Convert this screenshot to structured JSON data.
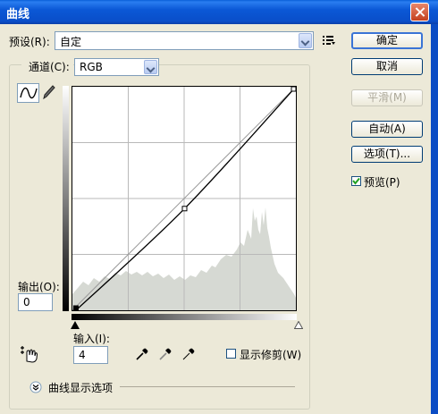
{
  "window": {
    "title": "曲线"
  },
  "preset": {
    "label": "预设(R):",
    "value": "自定"
  },
  "channel": {
    "label": "通道(C):",
    "value": "RGB"
  },
  "buttons": {
    "ok": "确定",
    "cancel": "取消",
    "smooth": "平滑(M)",
    "auto": "自动(A)",
    "options": "选项(T)..."
  },
  "preview": {
    "label": "预览(P)",
    "checked": true
  },
  "output": {
    "label": "输出(O):",
    "value": "0"
  },
  "input": {
    "label": "输入(I):",
    "value": "4"
  },
  "show_clipping": {
    "label": "显示修剪(W)",
    "checked": false
  },
  "curve_options": {
    "label": "曲线显示选项"
  },
  "curve": {
    "points": [
      [
        4,
        0
      ],
      [
        128,
        116
      ],
      [
        255,
        255
      ]
    ]
  }
}
